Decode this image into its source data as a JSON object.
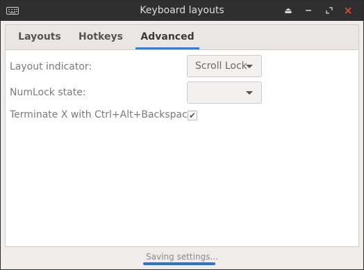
{
  "window": {
    "title": "Keyboard layouts",
    "icon": "keyboard-icon",
    "controls": [
      "eject-icon",
      "minimize-icon",
      "maximize-icon",
      "close-icon"
    ],
    "close_glyph": "×"
  },
  "tabs": [
    {
      "label": "Layouts",
      "active": false
    },
    {
      "label": "Hotkeys",
      "active": false
    },
    {
      "label": "Advanced",
      "active": true
    }
  ],
  "advanced": {
    "layout_indicator": {
      "label": "Layout indicator:",
      "value": "Scroll Lock"
    },
    "numlock_state": {
      "label": "NumLock state:",
      "value": ""
    },
    "terminate_x": {
      "label": "Terminate X with Ctrl+Alt+Backspace:",
      "checked": true,
      "check_glyph": "✔"
    }
  },
  "status": {
    "text": "Saving settings...",
    "progress": 1.0
  },
  "colors": {
    "accent": "#3b7ccf",
    "close": "#e14b3b",
    "titlebar": "#2f2f2f"
  }
}
